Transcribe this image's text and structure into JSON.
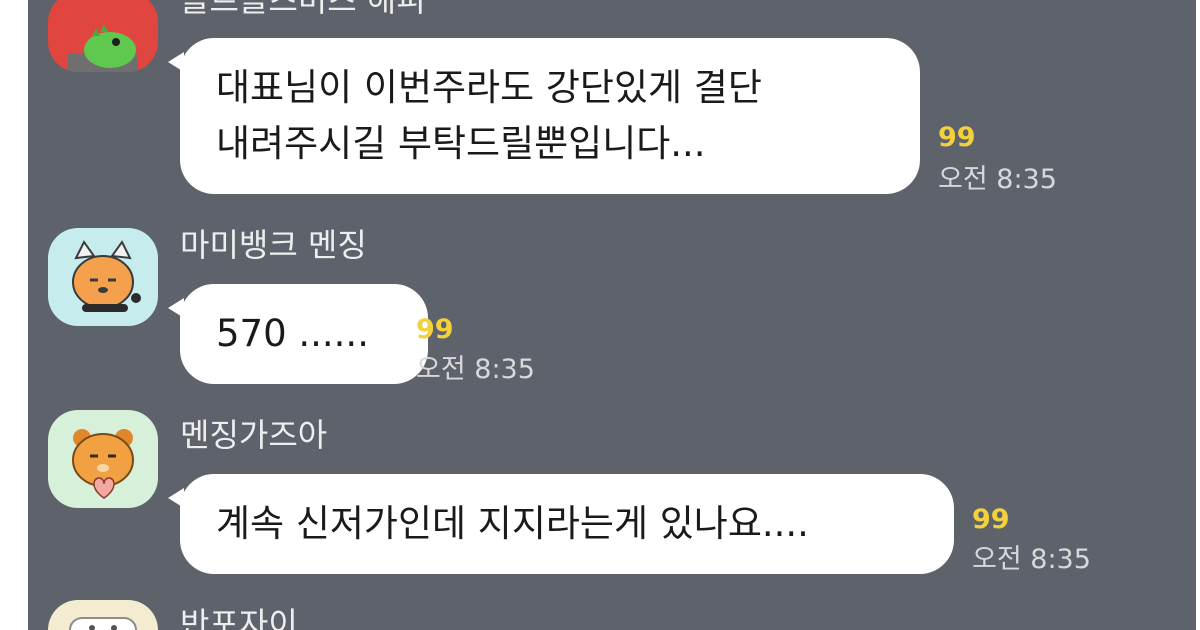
{
  "chat": {
    "messages": [
      {
        "sender": "플르플즈미즈 해피",
        "lines": [
          "대표님이 이번주라도 강단있게 결단",
          "내려주시길 부탁드릴뿐입니다..."
        ],
        "unread": "99",
        "time": "오전 8:35"
      },
      {
        "sender": "마미뱅크 멘징",
        "lines": [
          "570 ......"
        ],
        "unread": "99",
        "time": "오전 8:35"
      },
      {
        "sender": "멘징가즈아",
        "lines": [
          "계속 신저가인데 지지라는게 있나요...."
        ],
        "unread": "99",
        "time": "오전 8:35"
      },
      {
        "sender": "반포자이",
        "lines": [],
        "unread": "",
        "time": ""
      }
    ]
  },
  "avatars": [
    {
      "icon": "green-dinosaur-icon",
      "bg": "#e0463f"
    },
    {
      "icon": "cat-character-icon",
      "bg": "#c7ecee"
    },
    {
      "icon": "lion-character-icon",
      "bg": "#d6f0da"
    },
    {
      "icon": "character-icon",
      "bg": "#f3ecd0"
    }
  ],
  "colors": {
    "background": "#5d626b",
    "bubble": "#ffffff",
    "unread": "#f2d13d",
    "timestamp": "#d8d8d8",
    "sender_name": "#eeeeee"
  }
}
